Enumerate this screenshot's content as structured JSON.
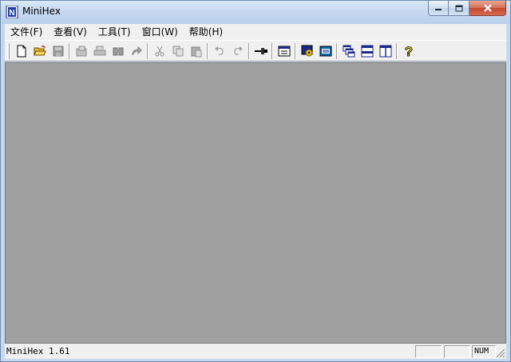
{
  "window": {
    "title": "MiniHex",
    "icon": "minihex-app-icon",
    "controls": [
      "minimize-icon",
      "maximize-icon",
      "close-icon"
    ]
  },
  "menu": [
    {
      "label": "文件(F)"
    },
    {
      "label": "查看(V)"
    },
    {
      "label": "工具(T)"
    },
    {
      "label": "窗口(W)"
    },
    {
      "label": "帮助(H)"
    }
  ],
  "toolbar": {
    "buttons": [
      {
        "icon": "new-file-icon",
        "enabled": true
      },
      {
        "icon": "open-folder-icon",
        "enabled": true
      },
      {
        "icon": "save-icon",
        "enabled": false
      },
      {
        "icon": "properties-icon",
        "enabled": false
      },
      {
        "icon": "print-icon",
        "enabled": false
      },
      {
        "icon": "find-binoculars-icon",
        "enabled": false
      },
      {
        "icon": "goto-arrow-icon",
        "enabled": false
      },
      {
        "icon": "cut-icon",
        "enabled": false
      },
      {
        "icon": "copy-icon",
        "enabled": false
      },
      {
        "icon": "paste-icon",
        "enabled": false
      },
      {
        "icon": "undo-icon",
        "enabled": false
      },
      {
        "icon": "redo-icon",
        "enabled": false
      },
      {
        "icon": "pin-icon",
        "enabled": true
      },
      {
        "icon": "view-window-icon",
        "enabled": true
      },
      {
        "icon": "settings-gear-icon",
        "enabled": true
      },
      {
        "icon": "hex-view-icon",
        "enabled": true
      },
      {
        "icon": "cascade-windows-icon",
        "enabled": true
      },
      {
        "icon": "tile-horizontal-icon",
        "enabled": true
      },
      {
        "icon": "tile-vertical-icon",
        "enabled": true
      },
      {
        "icon": "help-question-icon",
        "enabled": true
      }
    ]
  },
  "status": {
    "message": "MiniHex 1.61",
    "panes": [
      "",
      "",
      "NUM"
    ]
  },
  "colors": {
    "client_background": "#a0a0a0",
    "titlebar": "#c6d9f0",
    "chrome": "#f0f0f0"
  }
}
